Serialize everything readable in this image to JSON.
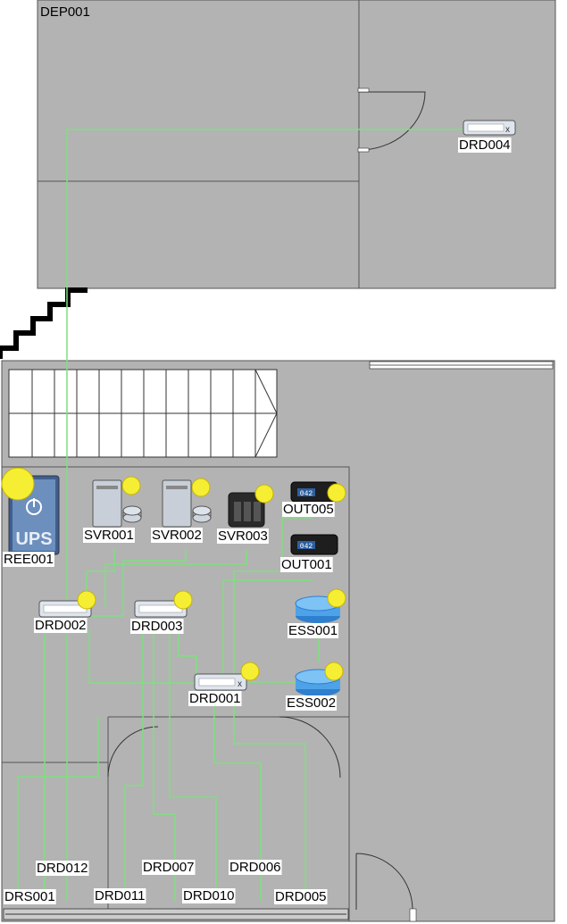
{
  "rooms": {
    "top_building": "DEP001"
  },
  "devices": [
    {
      "id": "DRD004",
      "kind": "patch-panel",
      "badge": false
    },
    {
      "id": "REE001",
      "kind": "ups",
      "badge": true,
      "icon_text": "UPS"
    },
    {
      "id": "SVR001",
      "kind": "server",
      "badge": true
    },
    {
      "id": "SVR002",
      "kind": "server",
      "badge": true
    },
    {
      "id": "SVR003",
      "kind": "nas",
      "badge": true
    },
    {
      "id": "OUT005",
      "kind": "media-converter",
      "badge": true,
      "icon_text": "042"
    },
    {
      "id": "OUT001",
      "kind": "media-converter",
      "badge": false,
      "icon_text": "042"
    },
    {
      "id": "ESS001",
      "kind": "router",
      "badge": true
    },
    {
      "id": "ESS002",
      "kind": "router",
      "badge": true
    },
    {
      "id": "DRD002",
      "kind": "patch-panel",
      "badge": true
    },
    {
      "id": "DRD003",
      "kind": "patch-panel",
      "badge": true
    },
    {
      "id": "DRD001",
      "kind": "patch-panel",
      "badge": true
    }
  ],
  "endpoints": [
    "DRD012",
    "DRD007",
    "DRD006",
    "DRS001",
    "DRD011",
    "DRD010",
    "DRD005"
  ],
  "colors": {
    "floor": "#b3b3b3",
    "wall": "#555555",
    "cable": "#7fe07f",
    "badge": "#f5ee32",
    "stair": "#000000",
    "label_bg": "#ffffff"
  }
}
